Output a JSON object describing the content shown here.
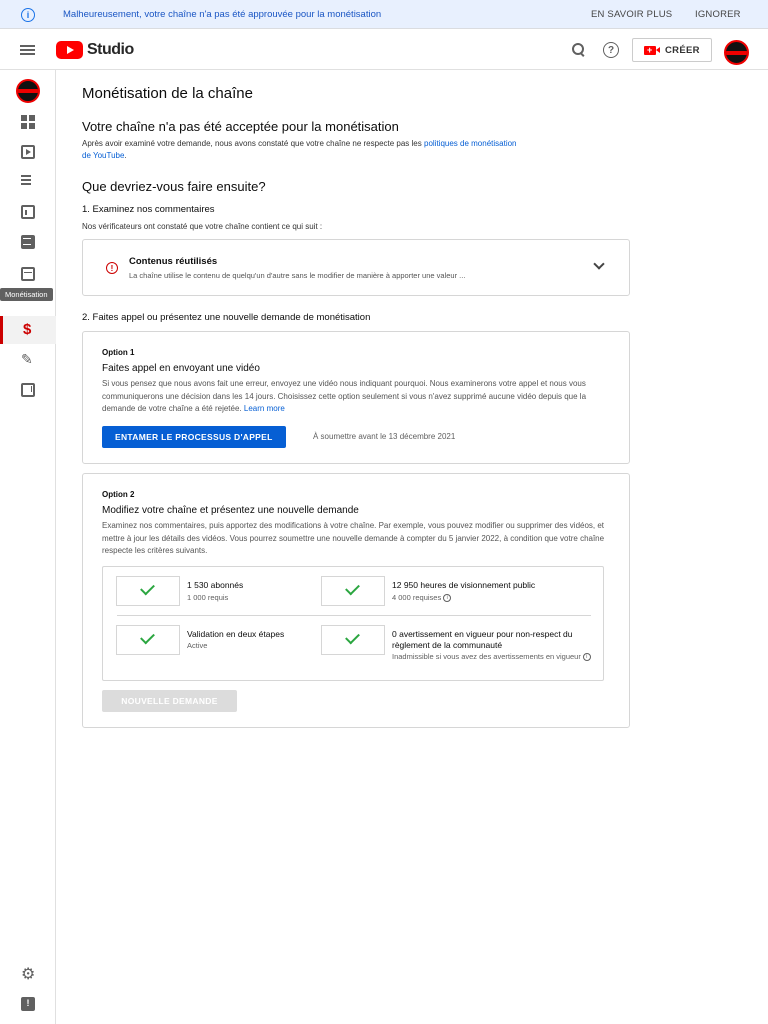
{
  "banner": {
    "message": "Malheureusement, votre chaîne n'a pas été approuvée pour la monétisation",
    "learn_more": "EN SAVOIR PLUS",
    "dismiss": "IGNORER"
  },
  "header": {
    "logo_text": "Studio",
    "create_label": "CRÉER",
    "icons": [
      "menu-icon",
      "search-icon",
      "help-icon",
      "camera-icon"
    ]
  },
  "sidebar": {
    "items": [
      "dashboard-icon",
      "content-icon",
      "playlists-icon",
      "analytics-icon",
      "comments-icon",
      "subtitles-icon",
      "monetization-icon",
      "customization-icon",
      "audio-library-icon"
    ],
    "active_tooltip": "Monétisation",
    "footer_items": [
      "settings-icon",
      "feedback-icon"
    ]
  },
  "main": {
    "page_title": "Monétisation de la chaîne",
    "rejected_heading": "Votre chaîne n'a pas été acceptée pour la monétisation",
    "rejected_text": "Après avoir examiné votre demande, nous avons constaté que votre chaîne ne respecte pas les",
    "rejected_link": "politiques de monétisation de YouTube",
    "rejected_link_suffix": ".",
    "next_heading": "Que devriez-vous faire ensuite?",
    "step1_title": "1. Examinez nos commentaires",
    "step1_text": "Nos vérificateurs ont constaté que votre chaîne contient ce qui suit :",
    "issue": {
      "title": "Contenus réutilisés",
      "description": "La chaîne utilise le contenu de quelqu'un d'autre sans le modifier de manière à apporter une valeur ..."
    },
    "step2_title": "2. Faites appel ou présentez une nouvelle demande de monétisation",
    "option1": {
      "label": "Option 1",
      "title": "Faites appel en envoyant une vidéo",
      "text": "Si vous pensez que nous avons fait une erreur, envoyez une vidéo nous indiquant pourquoi. Nous examinerons votre appel et nous vous communiquerons une décision dans les 14 jours. Choisissez cette option seulement si vous n'avez supprimé aucune vidéo depuis que la demande de votre chaîne a été rejetée.",
      "link": "Learn more",
      "button": "ENTAMER LE PROCESSUS D'APPEL",
      "deadline": "À soumettre avant le 13 décembre 2021"
    },
    "option2": {
      "label": "Option 2",
      "title": "Modifiez votre chaîne et présentez une nouvelle demande",
      "text": "Examinez nos commentaires, puis apportez des modifications à votre chaîne. Par exemple, vous pouvez modifier ou supprimer des vidéos, et mettre à jour les détails des vidéos. Vous pourrez soumettre une nouvelle demande à compter du 5 janvier 2022, à condition que votre chaîne respecte les critères suivants.",
      "requirements": [
        {
          "title": "1 530 abonnés",
          "subtitle": "1 000 requis"
        },
        {
          "title": "12 950 heures de visionnement public",
          "subtitle": "4 000 requises"
        },
        {
          "title": "Validation en deux étapes",
          "subtitle": "Active"
        },
        {
          "title": "0 avertissement en vigueur pour non-respect du règlement de la communauté",
          "subtitle": "Inadmissible si vous avez des avertissements en vigueur"
        }
      ],
      "button": "NOUVELLE DEMANDE"
    }
  }
}
